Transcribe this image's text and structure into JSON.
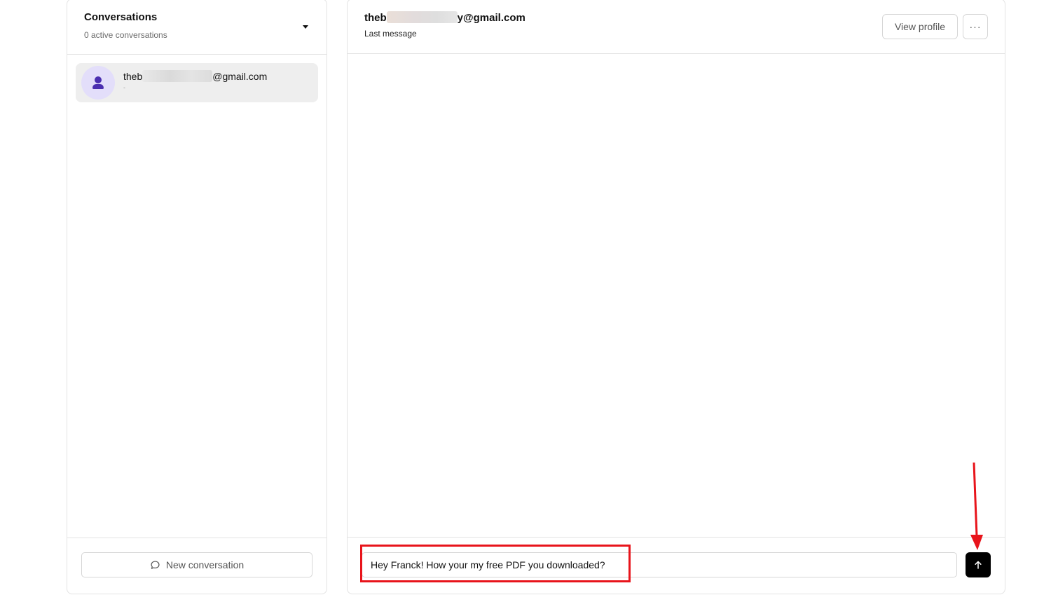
{
  "conversations_panel": {
    "title": "Conversations",
    "subtitle": "0 active conversations",
    "items": [
      {
        "email_prefix": "theb",
        "email_suffix": "@gmail.com",
        "last_message": "-"
      }
    ],
    "new_conversation_label": "New conversation"
  },
  "chat": {
    "header": {
      "email_prefix": "theb",
      "email_suffix": "y@gmail.com",
      "subtitle": "Last message",
      "view_profile_label": "View profile",
      "more_label": "···"
    },
    "composer": {
      "value": "Hey Franck! How your my free PDF you downloaded?"
    }
  },
  "annotations": {
    "color": "#e8141b"
  },
  "colors": {
    "avatar_bg": "#e3defa",
    "avatar_icon": "#4b2fb0",
    "send_button": "#000000",
    "selected_item_bg": "#eeeeee"
  },
  "icons": {
    "dropdown": "caret-down-icon",
    "avatar": "user-icon",
    "new_conversation": "chat-bubble-icon",
    "more": "ellipsis-icon",
    "send": "arrow-up-icon"
  }
}
